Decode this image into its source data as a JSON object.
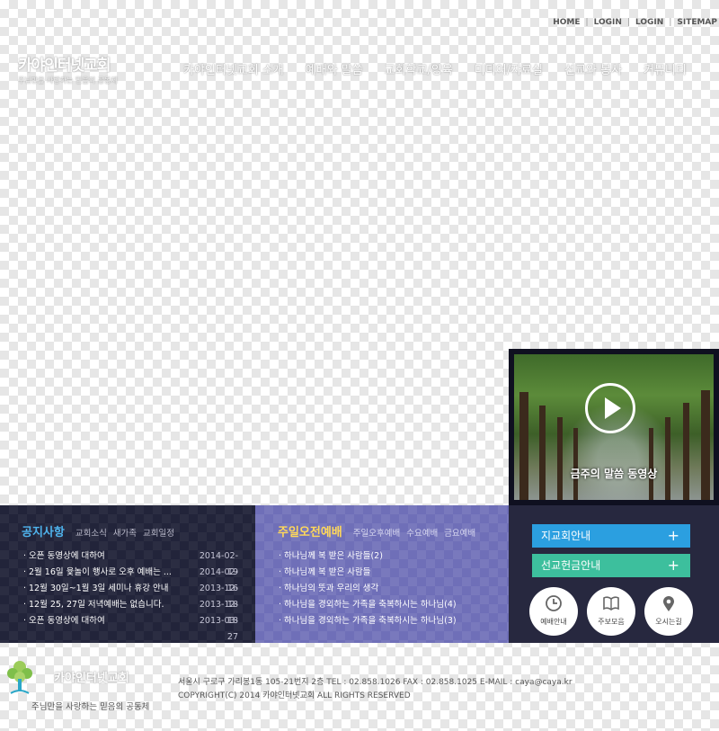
{
  "top_nav": [
    "HOME",
    "LOGIN",
    "LOGIN",
    "SITEMAP"
  ],
  "logo": {
    "title": "카야인터넷교회",
    "subtitle": "주님만을 사랑하는 믿음의 공동체"
  },
  "gnb": [
    "카야인터넷교회 소개",
    "예배와 말씀",
    "교회학교/양육",
    "미디어/자료실",
    "선교와 봉사",
    "커뮤니티"
  ],
  "video": {
    "caption": "금주의 말씀 동영상"
  },
  "notice": {
    "tab_main": "공지사항",
    "tabs_sub": [
      "교회소식",
      "새가족",
      "교회일정"
    ],
    "items": [
      {
        "title": "오픈 동영상에 대하여",
        "date": "2014-02-19"
      },
      {
        "title": "2월 16일 윷놀이 행사로 오후 예배는 ...",
        "date": "2014-02-16"
      },
      {
        "title": "12월 30일~1월 3일 세미나 휴강 안내",
        "date": "2013-12-18"
      },
      {
        "title": "12월 25, 27일 저녁예배는 없습니다.",
        "date": "2013-12-18"
      },
      {
        "title": "오픈 동영상에 대하여",
        "date": "2013-03-27"
      }
    ]
  },
  "worship": {
    "tab_main": "주일오전예배",
    "tabs_sub": [
      "주일오후예배",
      "수요예배",
      "금요예배"
    ],
    "items": [
      "하나님께 복 받은 사람들(2)",
      "하나님께 복 받은 사람들",
      "하나님의 뜻과 우리의 생각",
      "하나님을 경외하는 가족을 축복하시는 하나님(4)",
      "하나님을 경외하는 가족을 축복하시는 하나님(3)"
    ]
  },
  "quick": {
    "buttons": [
      "지교회안내",
      "선교헌금안내"
    ],
    "plus": "+",
    "circles": [
      "예배안내",
      "주보모음",
      "오시는길"
    ],
    "colors": {
      "btn1": "#2b9fe0",
      "btn2": "#3dbf9d"
    }
  },
  "footer": {
    "name": "카야인터넷교회",
    "slogan": "주님만을 사랑하는 믿음의 공동체",
    "address": "서울시 구로구 가리봉1동 105-21번지 2층 TEL : 02.858.1026  FAX : 02.858.1025  E-MAIL : caya@caya.kr",
    "copyright": "COPYRIGHT(C) 2014 카야인터넷교회 ALL RIGHTS RESERVED"
  }
}
